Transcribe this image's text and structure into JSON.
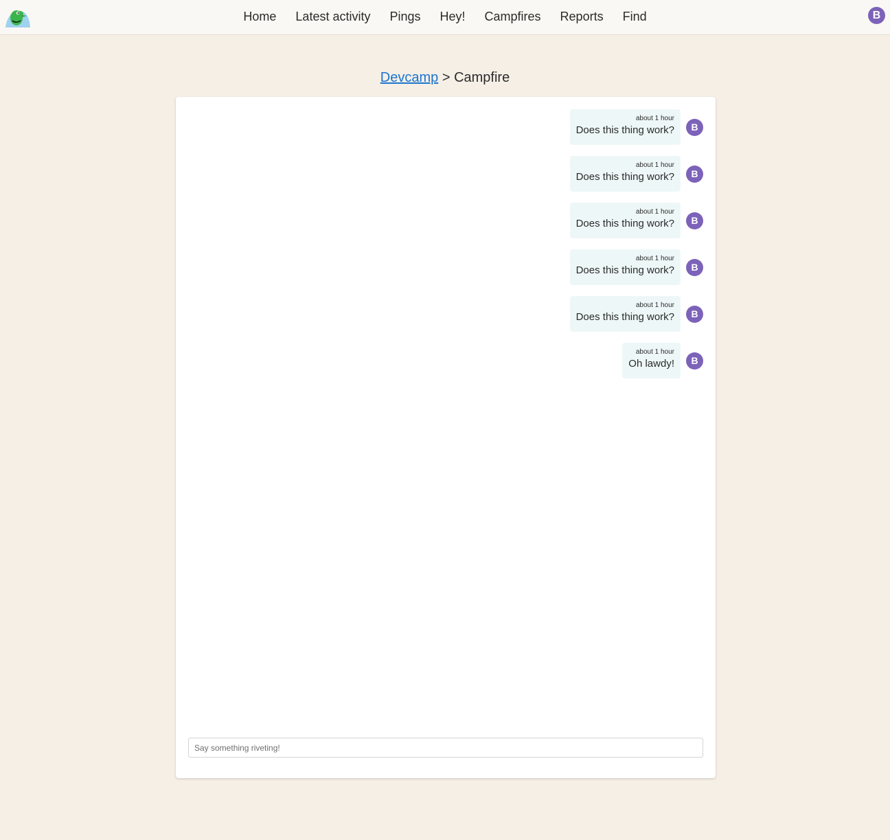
{
  "header": {
    "nav": [
      "Home",
      "Latest activity",
      "Pings",
      "Hey!",
      "Campfires",
      "Reports",
      "Find"
    ],
    "user_initial": "B"
  },
  "breadcrumb": {
    "project": "Devcamp",
    "separator": ">",
    "current": "Campfire"
  },
  "messages": [
    {
      "time": "about 1 hour",
      "text": "Does this thing work?",
      "avatar": "B"
    },
    {
      "time": "about 1 hour",
      "text": "Does this thing work?",
      "avatar": "B"
    },
    {
      "time": "about 1 hour",
      "text": "Does this thing work?",
      "avatar": "B"
    },
    {
      "time": "about 1 hour",
      "text": "Does this thing work?",
      "avatar": "B"
    },
    {
      "time": "about 1 hour",
      "text": "Does this thing work?",
      "avatar": "B"
    },
    {
      "time": "about 1 hour",
      "text": "Oh lawdy!",
      "avatar": "B"
    }
  ],
  "composer": {
    "placeholder": "Say something riveting!",
    "value": ""
  },
  "colors": {
    "page_bg": "#f5efe6",
    "avatar": "#7c62b9",
    "bubble": "#eef7f7",
    "link": "#1b75d0"
  }
}
